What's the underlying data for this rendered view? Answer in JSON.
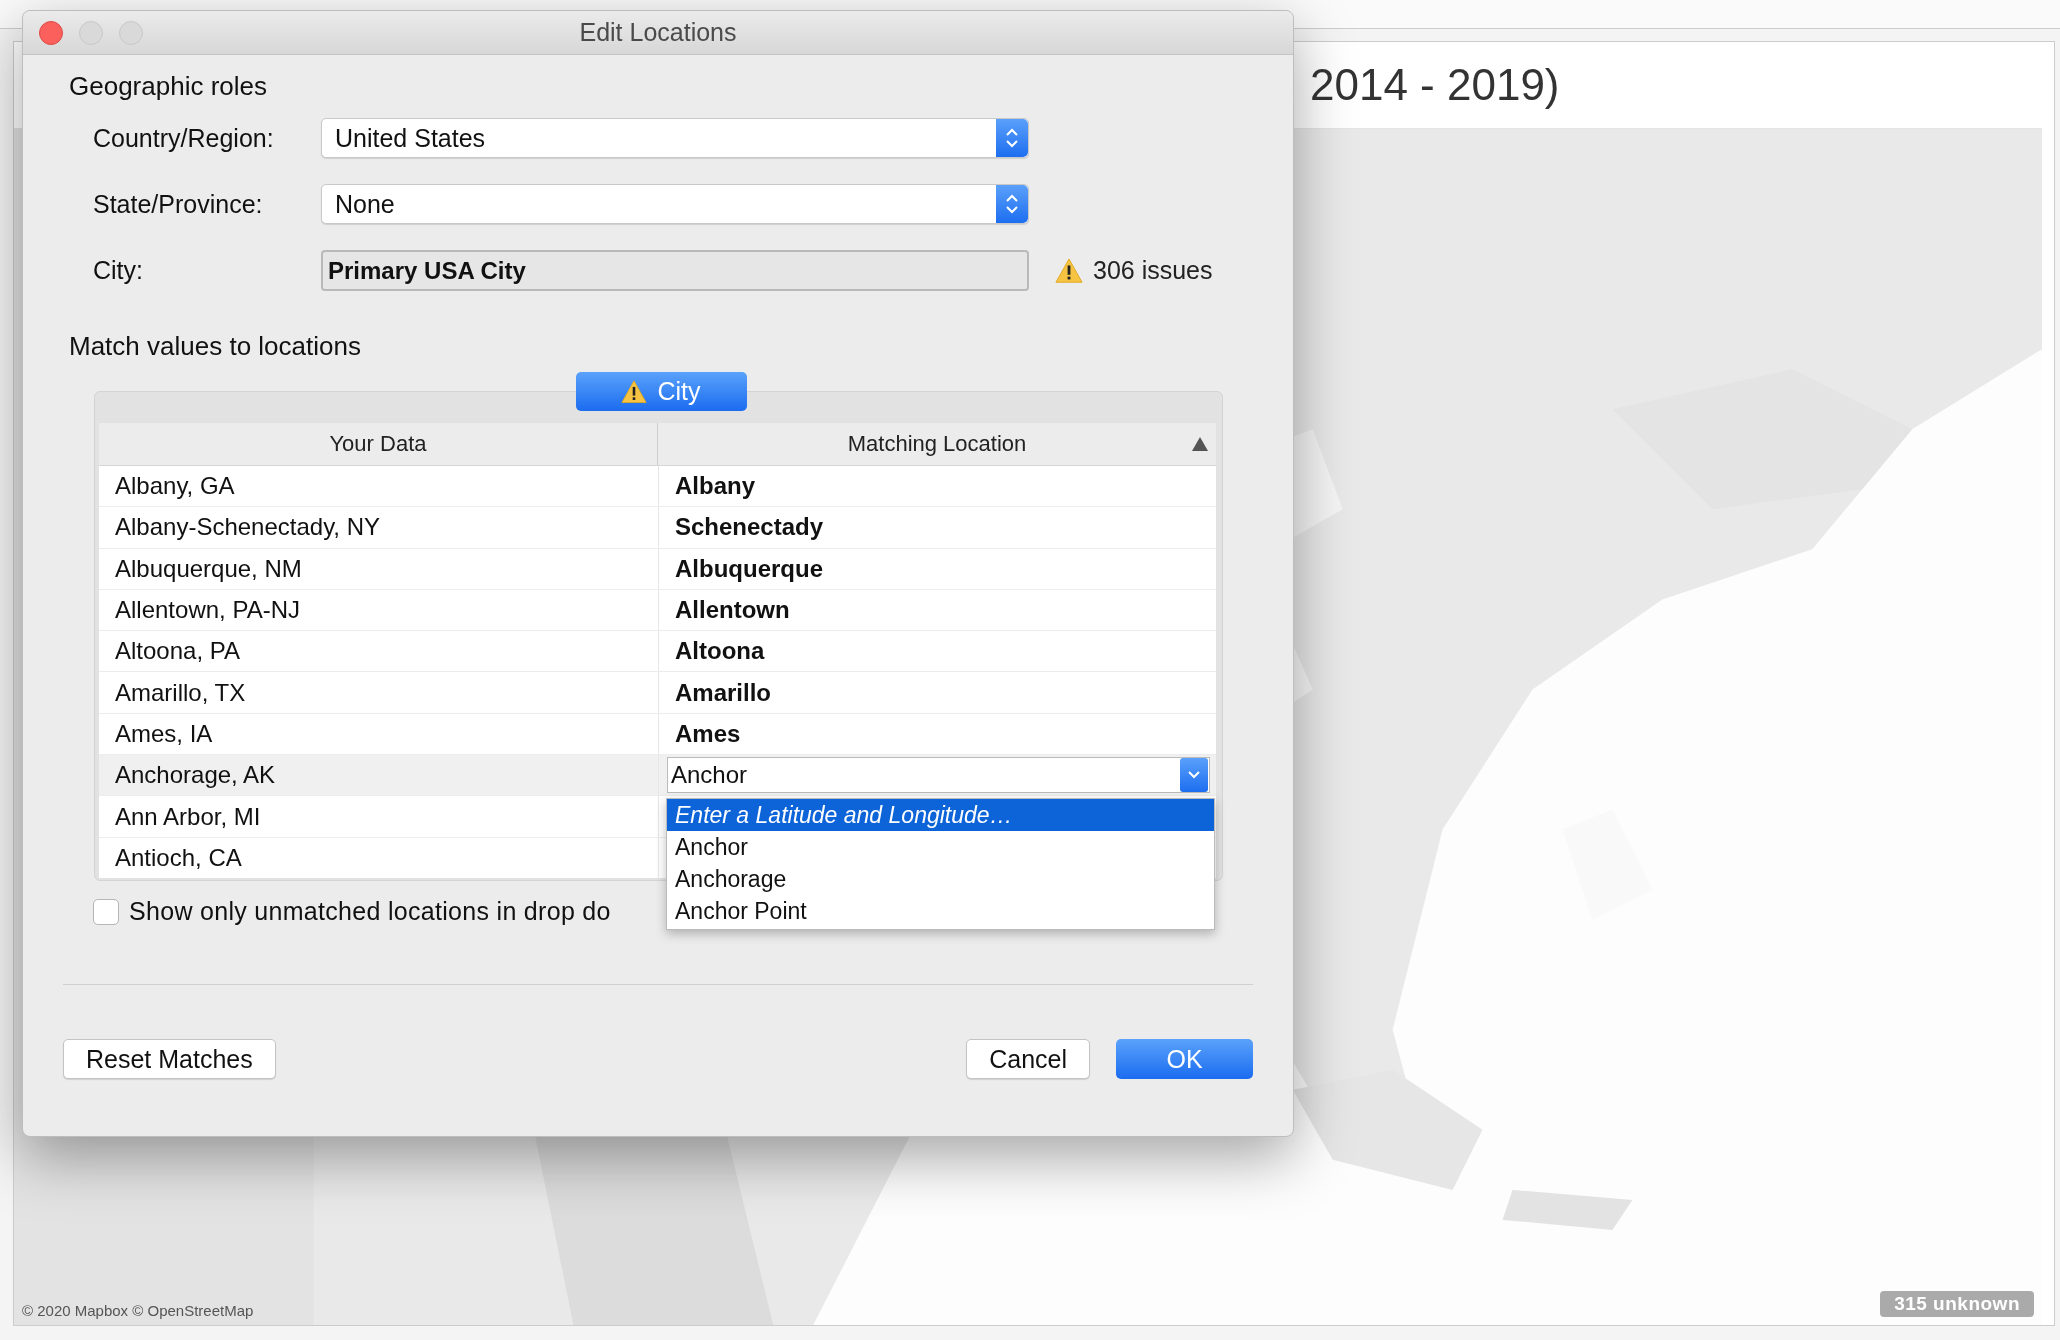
{
  "background": {
    "sheet_title": "2014 - 2019)",
    "attribution": "© 2020 Mapbox © OpenStreetMap",
    "unknown_badge": "315 unknown"
  },
  "dialog": {
    "title": "Edit Locations",
    "section_roles": "Geographic roles",
    "fields": [
      {
        "kind": "select",
        "label": "Country/Region:",
        "value": "United States"
      },
      {
        "kind": "select",
        "label": "State/Province:",
        "value": "None"
      },
      {
        "kind": "readonly",
        "label": "City:",
        "value": "Primary USA City",
        "warning": "306 issues"
      }
    ],
    "section_match": "Match values to locations",
    "level_tab": "City",
    "table": {
      "columns": [
        "Your Data",
        "Matching Location"
      ],
      "rows": [
        {
          "data": "Albany, GA",
          "match": "Albany",
          "editing": false
        },
        {
          "data": "Albany-Schenectady, NY",
          "match": "Schenectady",
          "editing": false
        },
        {
          "data": "Albuquerque, NM",
          "match": "Albuquerque",
          "editing": false
        },
        {
          "data": "Allentown, PA-NJ",
          "match": "Allentown",
          "editing": false
        },
        {
          "data": "Altoona, PA",
          "match": "Altoona",
          "editing": false
        },
        {
          "data": "Amarillo, TX",
          "match": "Amarillo",
          "editing": false
        },
        {
          "data": "Ames, IA",
          "match": "Ames",
          "editing": false
        },
        {
          "data": "Anchorage, AK",
          "match": "Anchor",
          "editing": true
        },
        {
          "data": "Ann Arbor, MI",
          "editing": false
        },
        {
          "data": "Antioch, CA",
          "editing": false
        }
      ]
    },
    "dropdown": {
      "options": [
        {
          "label": "Enter a Latitude and Longitude…",
          "kind": "action",
          "selected": true
        },
        {
          "label": "Anchor",
          "kind": "place",
          "selected": false
        },
        {
          "label": "Anchorage",
          "kind": "place",
          "selected": false
        },
        {
          "label": "Anchor Point",
          "kind": "place",
          "selected": false
        }
      ]
    },
    "checkbox": {
      "label": "Show only unmatched locations in drop do",
      "checked": false
    },
    "buttons": [
      {
        "label": "Reset Matches",
        "kind": "secondary"
      },
      {
        "label": "Cancel",
        "kind": "secondary"
      },
      {
        "label": "OK",
        "kind": "primary"
      }
    ]
  }
}
